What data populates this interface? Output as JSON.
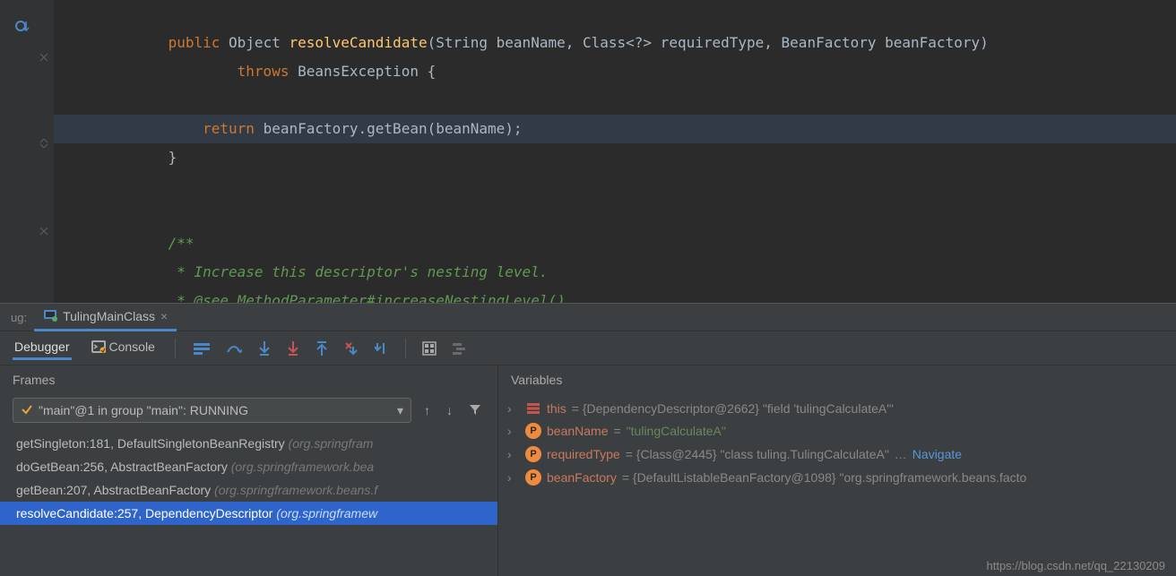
{
  "editor": {
    "lines": [
      {
        "indent": 3,
        "segments": []
      },
      {
        "indent": 3,
        "segments": [
          {
            "t": "public ",
            "c": "kw"
          },
          {
            "t": "Object ",
            "c": "plain"
          },
          {
            "t": "resolveCandidate",
            "c": "method"
          },
          {
            "t": "(String beanName, Class<?> requiredType, BeanFactory beanFactory)",
            "c": "plain"
          }
        ]
      },
      {
        "indent": 5,
        "segments": [
          {
            "t": "throws ",
            "c": "kw"
          },
          {
            "t": "BeansException {",
            "c": "plain"
          }
        ]
      },
      {
        "indent": 0,
        "segments": []
      },
      {
        "indent": 4,
        "hl": true,
        "segments": [
          {
            "t": "return ",
            "c": "kw"
          },
          {
            "t": "beanFactory.getBean(beanName);",
            "c": "plain"
          }
        ]
      },
      {
        "indent": 3,
        "segments": [
          {
            "t": "}",
            "c": "plain"
          }
        ]
      },
      {
        "indent": 0,
        "segments": []
      },
      {
        "indent": 0,
        "segments": []
      },
      {
        "indent": 3,
        "segments": [
          {
            "t": "/**",
            "c": "doccomment"
          }
        ]
      },
      {
        "indent": 3,
        "segments": [
          {
            "t": " * Increase this descriptor's nesting level.",
            "c": "doccomment"
          }
        ]
      },
      {
        "indent": 3,
        "segments": [
          {
            "t": " * ",
            "c": "doccomment"
          },
          {
            "t": "@see",
            "c": "doctag"
          },
          {
            "t": " MethodParameter#",
            "c": "doccomment"
          },
          {
            "t": "increaseNestingLevel()",
            "c": "doccomment"
          }
        ]
      }
    ]
  },
  "runbar": {
    "prefix": "ug:",
    "tab": "TulingMainClass"
  },
  "debugger": {
    "tabs": {
      "debugger": "Debugger",
      "console": "Console"
    }
  },
  "frames": {
    "title": "Frames",
    "thread": "\"main\"@1 in group \"main\": RUNNING",
    "items": [
      {
        "main": "getSingleton:181, DefaultSingletonBeanRegistry ",
        "pkg": "(org.springfram"
      },
      {
        "main": "doGetBean:256, AbstractBeanFactory ",
        "pkg": "(org.springframework.bea"
      },
      {
        "main": "getBean:207, AbstractBeanFactory ",
        "pkg": "(org.springframework.beans.f"
      },
      {
        "main": "resolveCandidate:257, DependencyDescriptor ",
        "pkg": "(org.springframew",
        "sel": true
      }
    ]
  },
  "variables": {
    "title": "Variables",
    "rows": [
      {
        "icon": "obj",
        "name": "this",
        "val": " = {DependencyDescriptor@2662} \"field 'tulingCalculateA'\""
      },
      {
        "icon": "p",
        "name": "beanName",
        "valPre": " = ",
        "str": "\"tulingCalculateA\""
      },
      {
        "icon": "p",
        "name": "requiredType",
        "val": " = {Class@2445} \"class tuling.TulingCalculateA\"",
        "link": "Navigate",
        "ellipsis": "… "
      },
      {
        "icon": "p",
        "name": "beanFactory",
        "val": " = {DefaultListableBeanFactory@1098} \"org.springframework.beans.facto"
      }
    ]
  },
  "watermark": "https://blog.csdn.net/qq_22130209"
}
